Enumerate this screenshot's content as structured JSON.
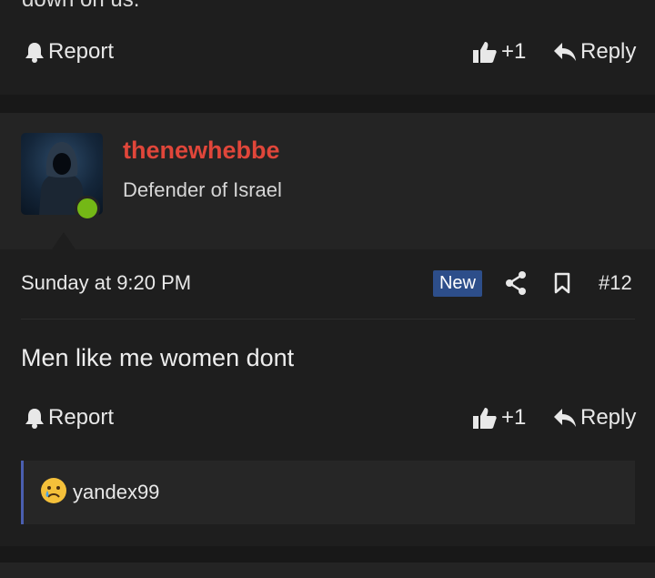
{
  "prev_post": {
    "cut_text": "down on us.",
    "report_label": "Report",
    "like_count": "+1",
    "reply_label": "Reply"
  },
  "post": {
    "username": "thenewhebbe",
    "user_title": "Defender of Israel",
    "date": "Sunday at 9:20 PM",
    "new_badge": "New",
    "post_number": "#12",
    "message": "Men like me women dont",
    "report_label": "Report",
    "like_count": "+1",
    "reply_label": "Reply",
    "reactions": [
      {
        "emoji": "sad-emoji",
        "user": "yandex99"
      }
    ]
  },
  "colors": {
    "background": "#1e1e1e",
    "username": "#e0463a",
    "online": "#74b816",
    "new_badge": "#2d4e8a",
    "reaction_border": "#4a5fb0"
  }
}
